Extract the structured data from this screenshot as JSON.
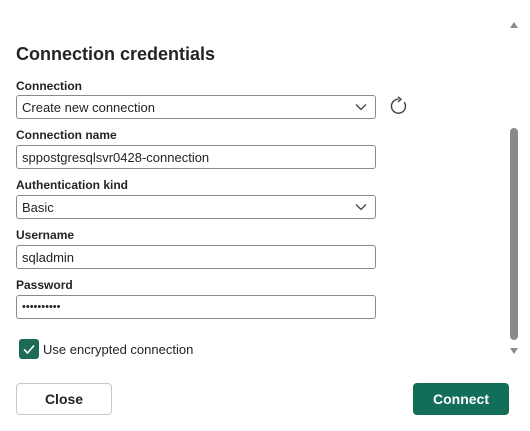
{
  "dialog": {
    "title": "Connection credentials",
    "connection": {
      "label": "Connection",
      "value": "Create new connection",
      "chevron_icon": "chevron-down-icon",
      "refresh_icon": "refresh-icon"
    },
    "connection_name": {
      "label": "Connection name",
      "value": "sppostgresqlsvr0428-connection"
    },
    "auth_kind": {
      "label": "Authentication kind",
      "value": "Basic",
      "chevron_icon": "chevron-down-icon"
    },
    "username": {
      "label": "Username",
      "value": "sqladmin"
    },
    "password": {
      "label": "Password",
      "value": "••••••••••"
    },
    "encrypted": {
      "label": "Use encrypted connection",
      "checked": true
    },
    "buttons": {
      "close": "Close",
      "connect": "Connect"
    }
  },
  "colors": {
    "accent": "#126e58",
    "checkbox": "#1d6b57",
    "border": "#8a8a8a"
  }
}
